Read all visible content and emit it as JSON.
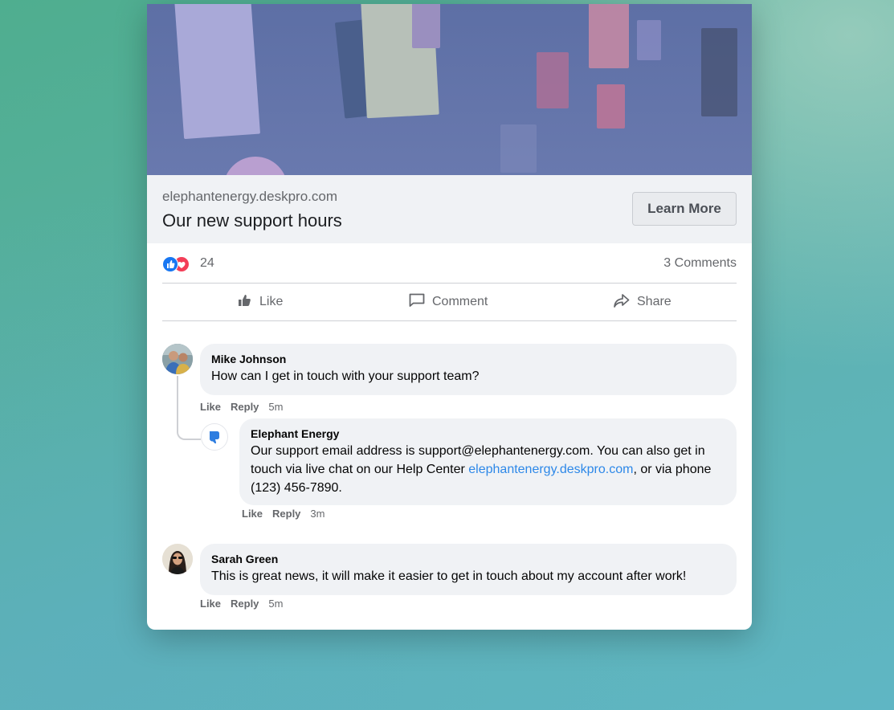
{
  "link_preview": {
    "domain": "elephantenergy.deskpro.com",
    "headline": "Our new support hours",
    "button_label": "Learn More"
  },
  "reactions": {
    "count": "24",
    "comments_label": "3 Comments"
  },
  "actions": {
    "like": "Like",
    "comment": "Comment",
    "share": "Share"
  },
  "comments": [
    {
      "author": "Mike Johnson",
      "text": "How can I get in touch with your support team?",
      "like": "Like",
      "reply": "Reply",
      "time": "5m"
    },
    {
      "author": "Elephant Energy",
      "text_before": "Our support email address is support@elephantenergy.com. You can also get in touch via live chat on our Help Center ",
      "link": "elephantenergy.deskpro.com",
      "text_after": ", or via phone (123) 456-7890.",
      "like": "Like",
      "reply": "Reply",
      "time": "3m"
    },
    {
      "author": "Sarah Green",
      "text": "This is great news, it will make it easier to get in touch about my account after work!",
      "like": "Like",
      "reply": "Reply",
      "time": "5m"
    }
  ],
  "colors": {
    "facebook_blue": "#1877f2",
    "love_red": "#f33e58",
    "link_blue": "#2d88e8",
    "bubble_gray": "#f0f2f5",
    "brand_blue": "#2d7de0"
  }
}
